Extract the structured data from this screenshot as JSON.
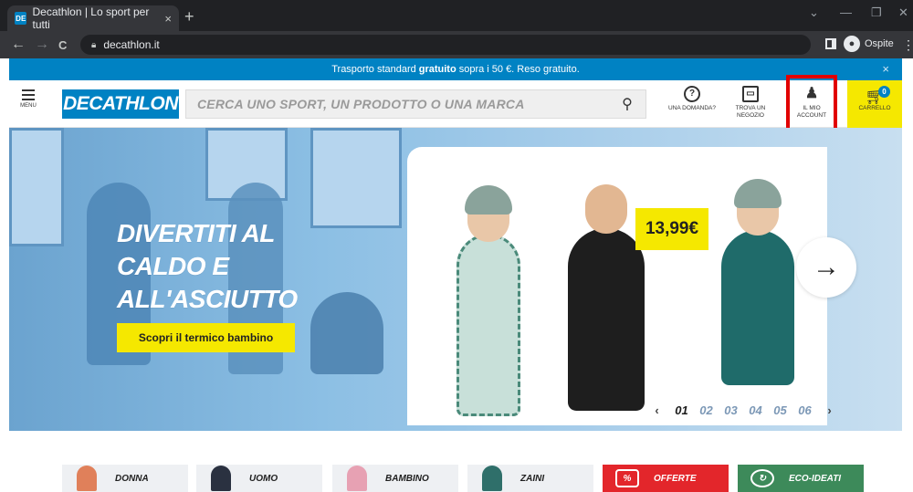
{
  "browser": {
    "tab_title": "Decathlon | Lo sport per tutti",
    "favicon_text": "DE",
    "tab_close": "×",
    "new_tab": "+",
    "url": "decathlon.it",
    "profile_label": "Ospite",
    "controls": {
      "minimize": "—",
      "restore": "❐",
      "close": "✕",
      "tabsearch": "⌄"
    },
    "nav": {
      "back": "←",
      "forward": "→",
      "reload": "C"
    }
  },
  "promo": {
    "text_before": "Trasporto standard",
    "bold": "gratuito",
    "text_after": "sopra i 50 €. Reso gratuito.",
    "close": "×"
  },
  "header": {
    "menu_label": "MENU",
    "logo": "DECATHLON",
    "search_placeholder": "CERCA UNO SPORT, UN PRODOTTO O UNA MARCA",
    "help_line1": "UNA DOMANDA?",
    "store_line1": "TROVA UN",
    "store_line2": "NEGOZIO",
    "account_line1": "IL MIO",
    "account_line2": "ACCOUNT",
    "cart_label": "CARRELLO",
    "cart_count": "0",
    "highlight_color": "#e10000"
  },
  "hero": {
    "title_line1": "DIVERTITI AL",
    "title_line2": "CALDO E",
    "title_line3": "ALL'ASCIUTTO",
    "cta": "Scopri il termico bambino",
    "price": "13,99€",
    "next_arrow": "→",
    "pager": {
      "prev": "‹",
      "pages": [
        "01",
        "02",
        "03",
        "04",
        "05",
        "06"
      ],
      "active": "01",
      "next": "›"
    }
  },
  "categories": [
    "DONNA",
    "UOMO",
    "BAMBINO",
    "ZAINI",
    "OFFERTE",
    "ECO-IDEATI"
  ],
  "colors": {
    "brand_blue": "#0082c3",
    "brand_yellow": "#f5e800",
    "offers_red": "#e3262b",
    "eco_green": "#3d8a5a"
  }
}
